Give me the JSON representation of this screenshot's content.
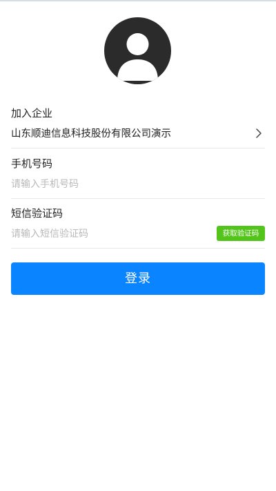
{
  "avatar": {
    "icon": "user-avatar-icon"
  },
  "company": {
    "label": "加入企业",
    "value": "山东顺迪信息科技股份有限公司演示",
    "chevron_icon": "chevron-right-icon"
  },
  "phone": {
    "label": "手机号码",
    "placeholder": "请输入手机号码"
  },
  "sms": {
    "label": "短信验证码",
    "placeholder": "请输入短信验证码",
    "get_code_label": "获取验证码"
  },
  "login": {
    "label": "登录"
  },
  "colors": {
    "primary": "#0a84ff",
    "success": "#52c41a",
    "avatar": "#2b2b2b",
    "placeholder": "#b9b9b9"
  }
}
